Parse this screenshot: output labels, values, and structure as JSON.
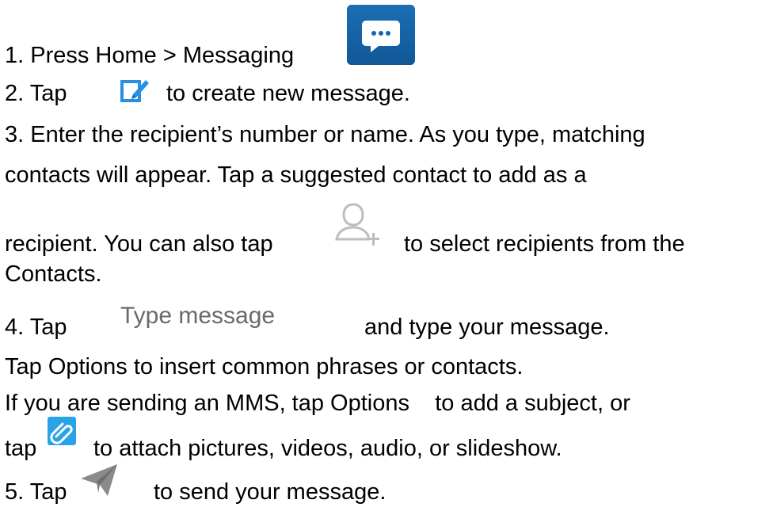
{
  "steps": {
    "s1": {
      "text": "1. Press Home > Messaging",
      "icon": "messaging-app-icon"
    },
    "s2": {
      "prefix": "2. Tap",
      "suffix": "to create new message.",
      "icon": "compose-icon"
    },
    "s3": {
      "line1": "3. Enter the recipient’s number or name. As you type, matching",
      "line2": "contacts will appear. Tap a suggested contact to add as a",
      "line3_prefix": "recipient. You can also tap",
      "line3_suffix": "to select recipients from the",
      "line4": "Contacts.",
      "icon": "add-contact-icon"
    },
    "s4": {
      "prefix": "4. Tap",
      "field_text": "Type message",
      "suffix": "and type your message.",
      "line2": "Tap Options    to insert common phrases or contacts.",
      "line3": "If you are sending an MMS, tap Options    to add a subject, or",
      "line4_prefix": "tap",
      "line4_suffix": "to attach pictures, videos, audio, or slideshow.",
      "icon": "paperclip-icon"
    },
    "s5": {
      "prefix": "5. Tap",
      "suffix": "to send your message.",
      "icon": "send-icon"
    }
  },
  "colors": {
    "messaging_icon_bg": "#1565a8",
    "compose_icon": "#2a8fe0",
    "add_contact_icon": "#bdbdbd",
    "paperclip_icon": "#29a3e8",
    "send_icon": "#8a8a8a",
    "field_text": "#6a6a6a"
  }
}
